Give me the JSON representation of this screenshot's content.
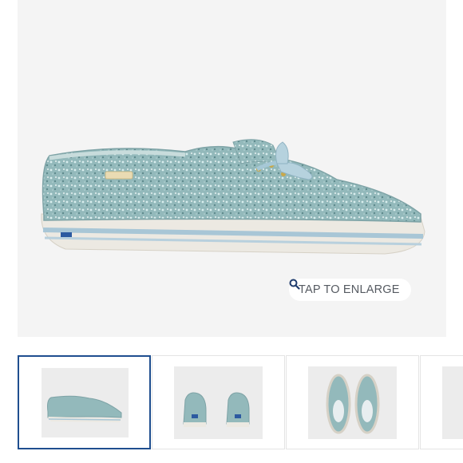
{
  "product_gallery": {
    "main_image_alt": "",
    "enlarge_label": "TAP TO ENLARGE",
    "enlarge_icon": "search-icon",
    "thumbnails": [
      {
        "view": "side",
        "selected": true
      },
      {
        "view": "back",
        "selected": false
      },
      {
        "view": "top",
        "selected": false
      },
      {
        "view": "partial",
        "selected": false
      }
    ]
  },
  "colors": {
    "accent_border": "#1f4e8f",
    "glitter": "#8fb6b8",
    "sole": "#ece9e2",
    "stripe": "#a8c6d6",
    "background": "#f4f4f4"
  }
}
